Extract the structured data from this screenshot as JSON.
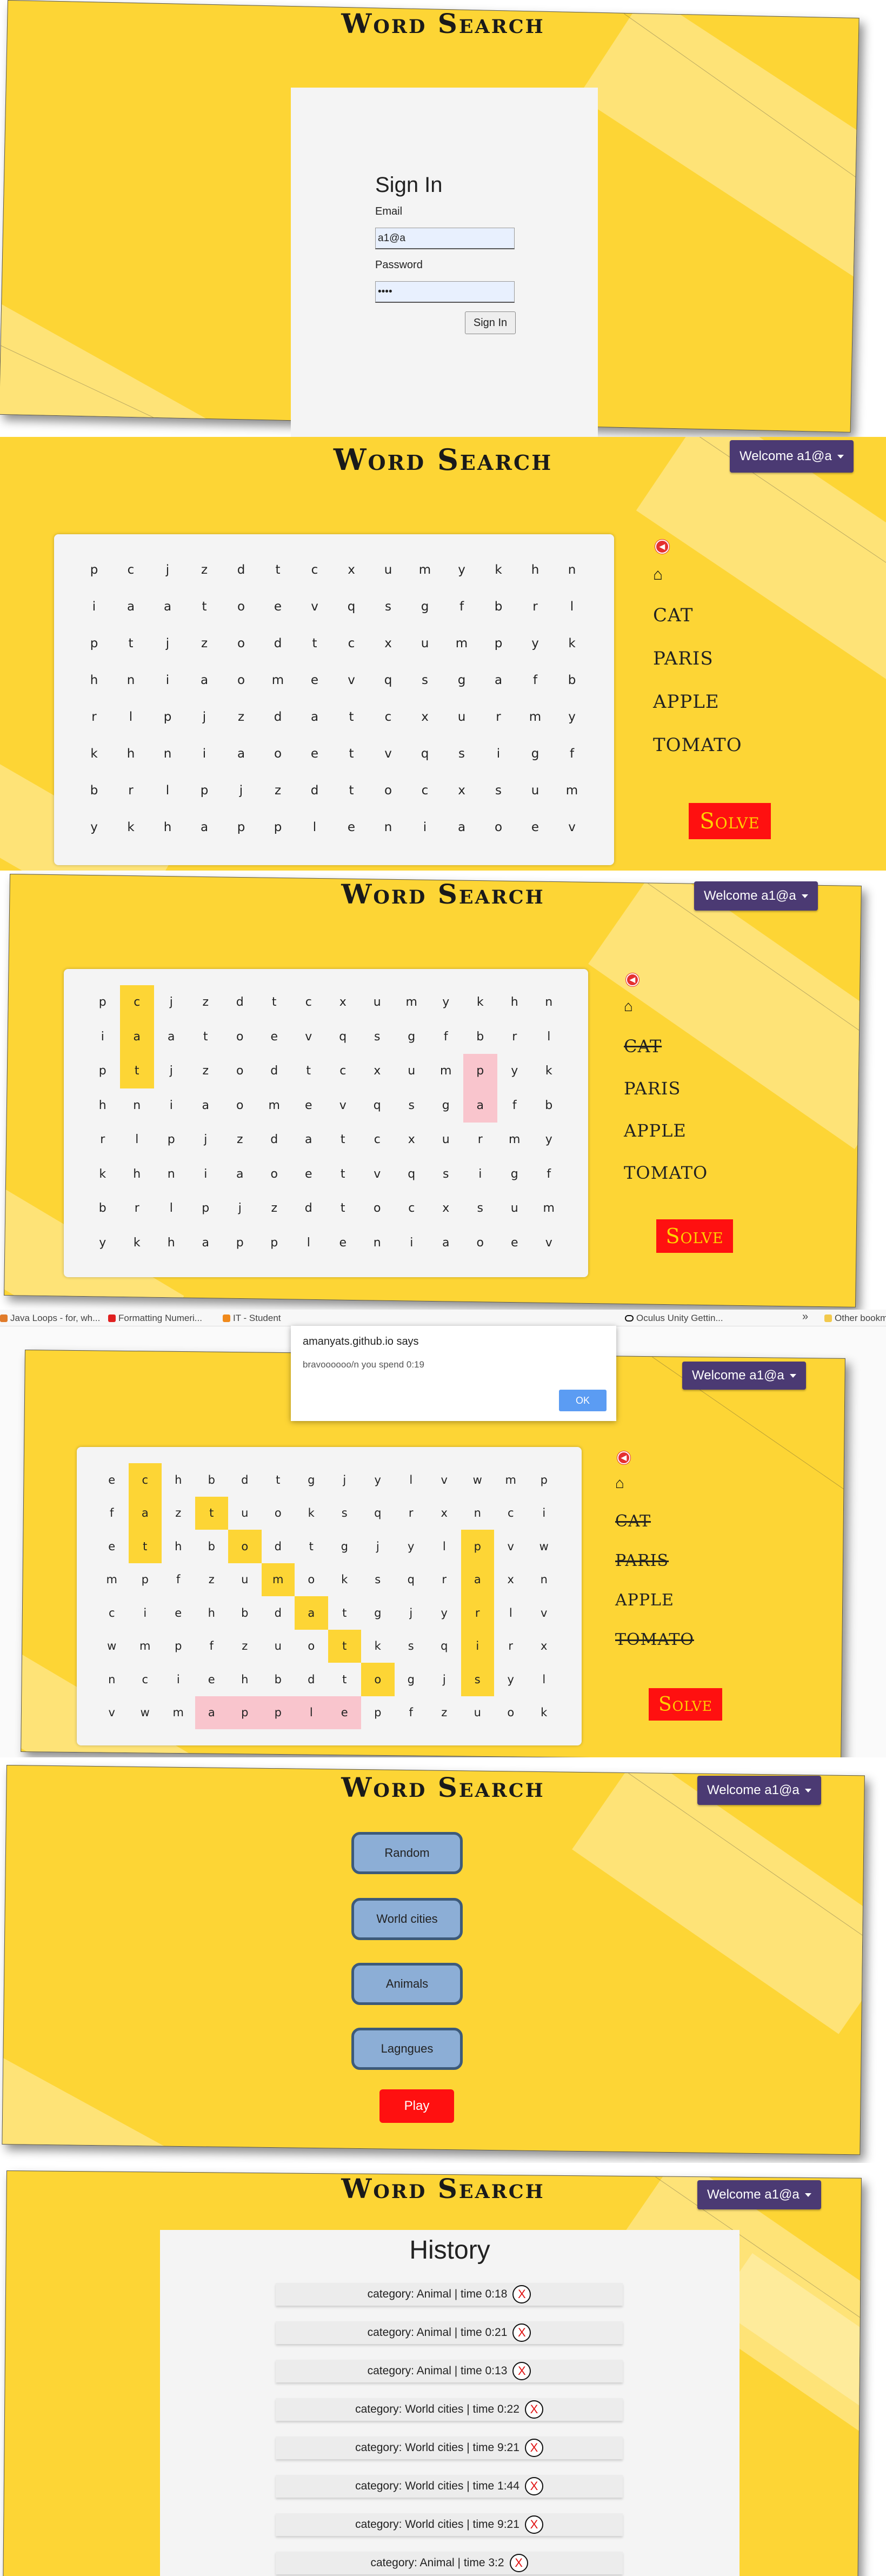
{
  "app_title": "Word Search",
  "signin": {
    "heading": "Sign In",
    "email_label": "Email",
    "email_value": "a1@a",
    "password_label": "Password",
    "password_value": "••••",
    "button": "Sign In"
  },
  "welcome_label": "Welcome a1@a",
  "solve_label": "Solve",
  "game1": {
    "grid": [
      "pcjzdtcxumykhn",
      "iaatoevqsgfbrl",
      "ptjzodtcxumpyk",
      "hnia omevqsgafb",
      "rlpjzdatcxurmy",
      "khnia oetvqsigf",
      "brlpjzdtocxsum",
      "ykhappleniaoev"
    ],
    "words": [
      "CAT",
      "PARIS",
      "APPLE",
      "TOMATO"
    ]
  },
  "game2": {
    "words": [
      "CAT",
      "PARIS",
      "APPLE",
      "TOMATO"
    ],
    "found": [
      true,
      false,
      false,
      false
    ]
  },
  "game3": {
    "grid": [
      "echbdtgjylvwmp",
      "faztuoksqrxnci",
      "ethbodtgjylpvw",
      "mpfzumoksqraxn",
      "ciehbdatgjyrlv",
      "wmpfzuotksqirx",
      "nciehbdtogjsyl",
      "vwmapplepfzuok"
    ],
    "words": [
      "CAT",
      "PARIS",
      "APPLE",
      "TOMATO"
    ],
    "found": [
      true,
      true,
      false,
      true
    ]
  },
  "browser": {
    "bookmarks": [
      "Java Loops - for, wh...",
      "Formatting Numeri...",
      "IT - Student",
      "Oculus Unity Gettin...",
      "Other bookmarks"
    ],
    "more": "»"
  },
  "alert": {
    "origin": "amanyats.github.io says",
    "message": "bravoooooo/n you spend 0:19",
    "ok": "OK"
  },
  "categories": {
    "items": [
      "Random",
      "World cities",
      "Animals",
      "Lagngues"
    ],
    "play": "Play"
  },
  "history": {
    "title": "History",
    "rows": [
      "category: Animal | time 0:18",
      "category: Animal | time 0:21",
      "category: Animal | time 0:13",
      "category: World cities | time 0:22",
      "category: World cities | time 9:21",
      "category: World cities | time 1:44",
      "category: World cities | time 9:21",
      "category: Animal | time 3:2"
    ],
    "delete_label": "X"
  },
  "colors": {
    "paper": "#fdd535",
    "highlight_yellow": "#fdd535",
    "highlight_pink": "#f9c5cd",
    "solve_bg": "#ff1010",
    "welcome_bg": "#4b3a73",
    "category_btn": "#8caed6"
  }
}
